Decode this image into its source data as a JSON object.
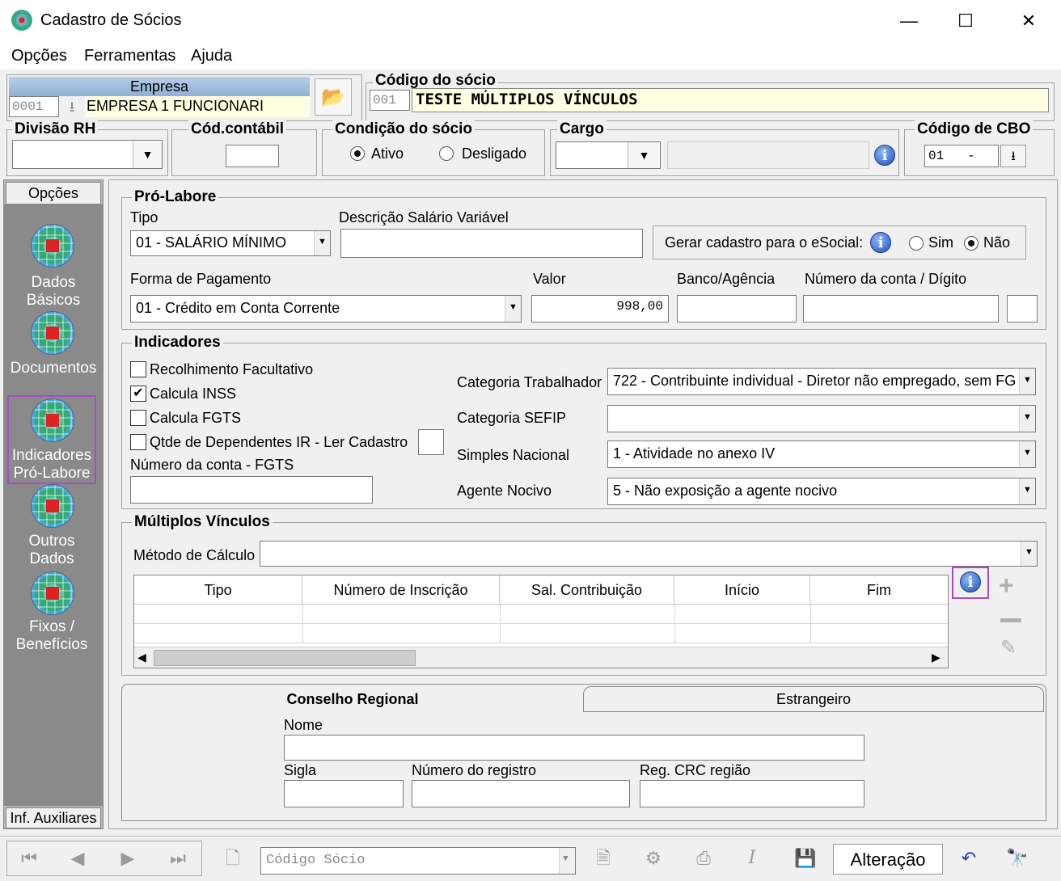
{
  "window": {
    "title": "Cadastro de Sócios"
  },
  "menu": [
    "Opções",
    "Ferramentas",
    "Ajuda"
  ],
  "empresa": {
    "header": "Empresa",
    "code": "0001",
    "name": "EMPRESA 1 FUNCIONARI"
  },
  "codigo_socio": {
    "label": "Código do sócio",
    "code": "001",
    "name": "TESTE MÚLTIPLOS VÍNCULOS"
  },
  "divisao": {
    "label": "Divisão RH",
    "value": ""
  },
  "cod_contabil": {
    "label": "Cód.contábil",
    "value": ""
  },
  "condicao": {
    "label": "Condição do sócio",
    "options": [
      "Ativo",
      "Desligado"
    ],
    "selected": "Ativo"
  },
  "cargo": {
    "label": "Cargo",
    "value": ""
  },
  "cbo": {
    "label": "Código de CBO",
    "value": "01   -"
  },
  "sidebar": {
    "header": "Opções",
    "items": [
      {
        "line1": "Dados",
        "line2": "Básicos"
      },
      {
        "line1": "Documentos",
        "line2": ""
      },
      {
        "line1": "Indicadores",
        "line2": "Pró-Labore"
      },
      {
        "line1": "Outros",
        "line2": "Dados"
      },
      {
        "line1": "Fixos /",
        "line2": "Benefícios"
      }
    ],
    "footer": "Inf. Auxiliares",
    "active_index": 2
  },
  "prolabore": {
    "title": "Pró-Labore",
    "tipo_label": "Tipo",
    "tipo_value": "01 - SALÁRIO MÍNIMO",
    "desc_label": "Descrição Salário Variável",
    "desc_value": "",
    "esocial_label": "Gerar cadastro para o eSocial:",
    "esocial_options": [
      "Sim",
      "Não"
    ],
    "esocial_selected": "Não",
    "forma_label": "Forma de Pagamento",
    "forma_value": "01 - Crédito em Conta Corrente",
    "valor_label": "Valor",
    "valor_value": "998,00",
    "banco_label": "Banco/Agência",
    "banco_value": "",
    "conta_label": "Número da conta / Dígito",
    "conta_value": "",
    "digito_value": ""
  },
  "indicadores": {
    "title": "Indicadores",
    "checks": [
      {
        "label": "Recolhimento Facultativo",
        "checked": false
      },
      {
        "label": "Calcula INSS",
        "checked": true
      },
      {
        "label": "Calcula FGTS",
        "checked": false
      },
      {
        "label": "Qtde de Dependentes IR - Ler Cadastro",
        "checked": false
      }
    ],
    "fgts_label": "Número da conta - FGTS",
    "fgts_value": "",
    "cat_trab_label": "Categoria Trabalhador",
    "cat_trab_value": "722 - Contribuinte individual - Diretor não empregado, sem FG",
    "cat_sefip_label": "Categoria SEFIP",
    "cat_sefip_value": "",
    "simples_label": "Simples Nacional",
    "simples_value": "1 - Atividade no anexo IV",
    "agente_label": "Agente Nocivo",
    "agente_value": "5 - Não exposição a agente nocivo"
  },
  "multiplos": {
    "title": "Múltiplos Vínculos",
    "metodo_label": "Método de Cálculo",
    "metodo_value": "",
    "columns": [
      "Tipo",
      "Número de Inscrição",
      "Sal. Contribuição",
      "Início",
      "Fim"
    ]
  },
  "tabs": {
    "items": [
      "Conselho Regional",
      "Estrangeiro"
    ],
    "active": "Conselho Regional",
    "nome_label": "Nome",
    "nome_value": "",
    "sigla_label": "Sigla",
    "sigla_value": "",
    "registro_label": "Número do registro",
    "registro_value": "",
    "crc_label": "Reg. CRC região",
    "crc_value": ""
  },
  "toolbar": {
    "search_placeholder": "Código Sócio",
    "status": "Alteração"
  }
}
